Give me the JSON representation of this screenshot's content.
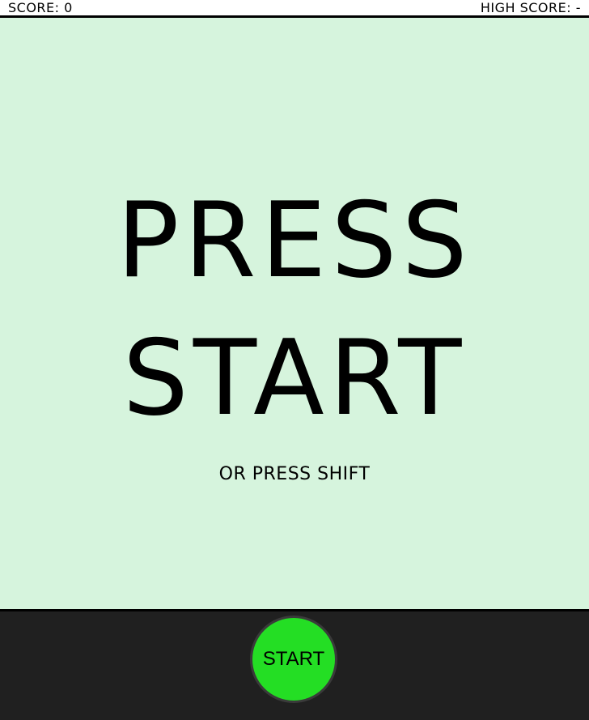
{
  "scoreboard": {
    "score_label": "SCORE: 0",
    "high_score_label": "HIGH SCORE: -"
  },
  "screen": {
    "title_line_1": "PRESS",
    "title_line_2": "START",
    "subtitle": "OR PRESS SHIFT"
  },
  "controls": {
    "start_label": "START"
  },
  "colors": {
    "screen_background": "#d6f4dd",
    "control_bar_background": "#202020",
    "start_button": "#24de24"
  }
}
